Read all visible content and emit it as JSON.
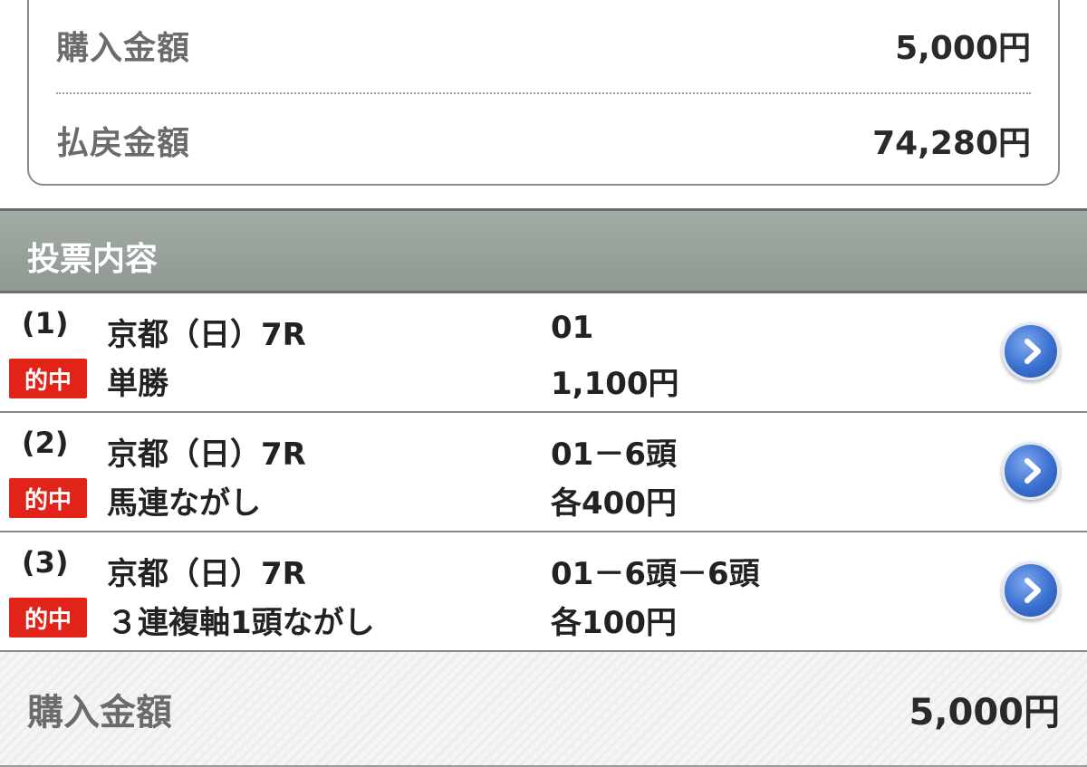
{
  "summary": {
    "purchase_label": "購入金額",
    "purchase_value": "5,000円",
    "payout_label": "払戻金額",
    "payout_value": "74,280円"
  },
  "section": {
    "title": "投票内容"
  },
  "bets": [
    {
      "num": "(1)",
      "race": "京都（日）7R",
      "badge": "的中",
      "type": "単勝",
      "combo": "01",
      "amount": "1,100円"
    },
    {
      "num": "(2)",
      "race": "京都（日）7R",
      "badge": "的中",
      "type": "馬連ながし",
      "combo": "01－6頭",
      "amount": "各400円"
    },
    {
      "num": "(3)",
      "race": "京都（日）7R",
      "badge": "的中",
      "type": "３連複軸1頭ながし",
      "combo": "01－6頭－6頭",
      "amount": "各100円"
    }
  ],
  "footer": {
    "label": "購入金額",
    "value": "5,000円"
  },
  "colors": {
    "hit_badge": "#e2231a",
    "header_bg": "#9aa29c",
    "arrow_button": "#3a6fd0"
  },
  "icons": {
    "row_action": "chevron-right-icon"
  }
}
